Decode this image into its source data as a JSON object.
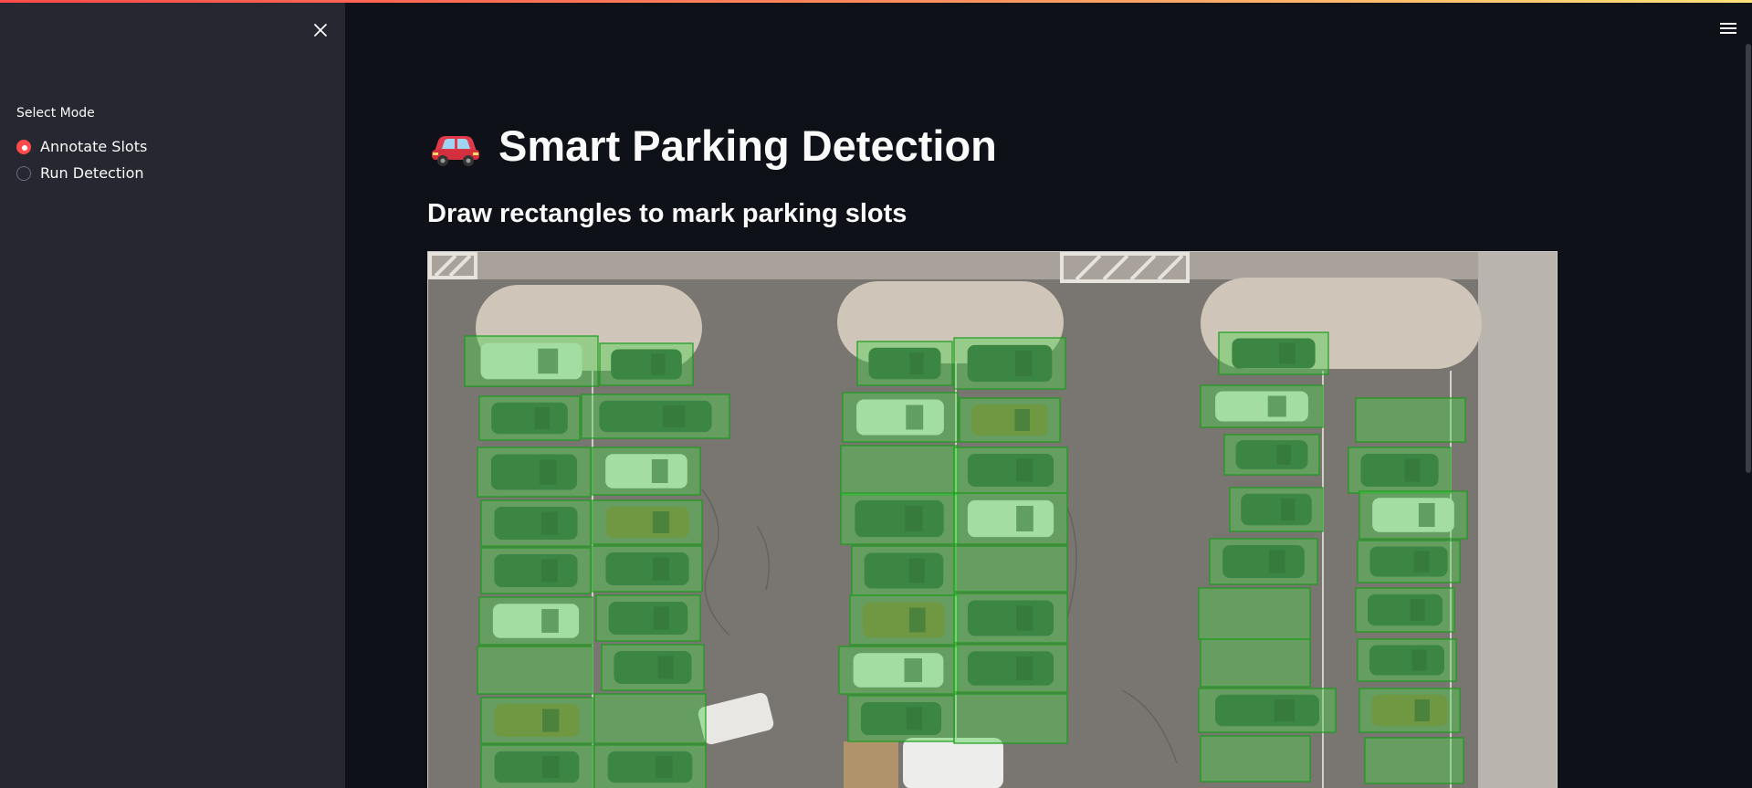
{
  "sidebar": {
    "close_icon": "close-icon",
    "radio": {
      "label": "Select Mode",
      "options": [
        {
          "label": "Annotate Slots",
          "selected": true
        },
        {
          "label": "Run Detection",
          "selected": false
        }
      ]
    }
  },
  "header": {
    "menu_icon": "hamburger-menu-icon"
  },
  "main": {
    "title_icon": "car-icon",
    "title": "Smart Parking Detection",
    "subtitle": "Draw rectangles to mark parking slots"
  },
  "colors": {
    "accent": "#ff4b4b",
    "slot_fill": "#4fd14f",
    "slot_stroke": "#1c9c1c",
    "sidebar_bg": "#262730",
    "main_bg": "#0e1117"
  }
}
